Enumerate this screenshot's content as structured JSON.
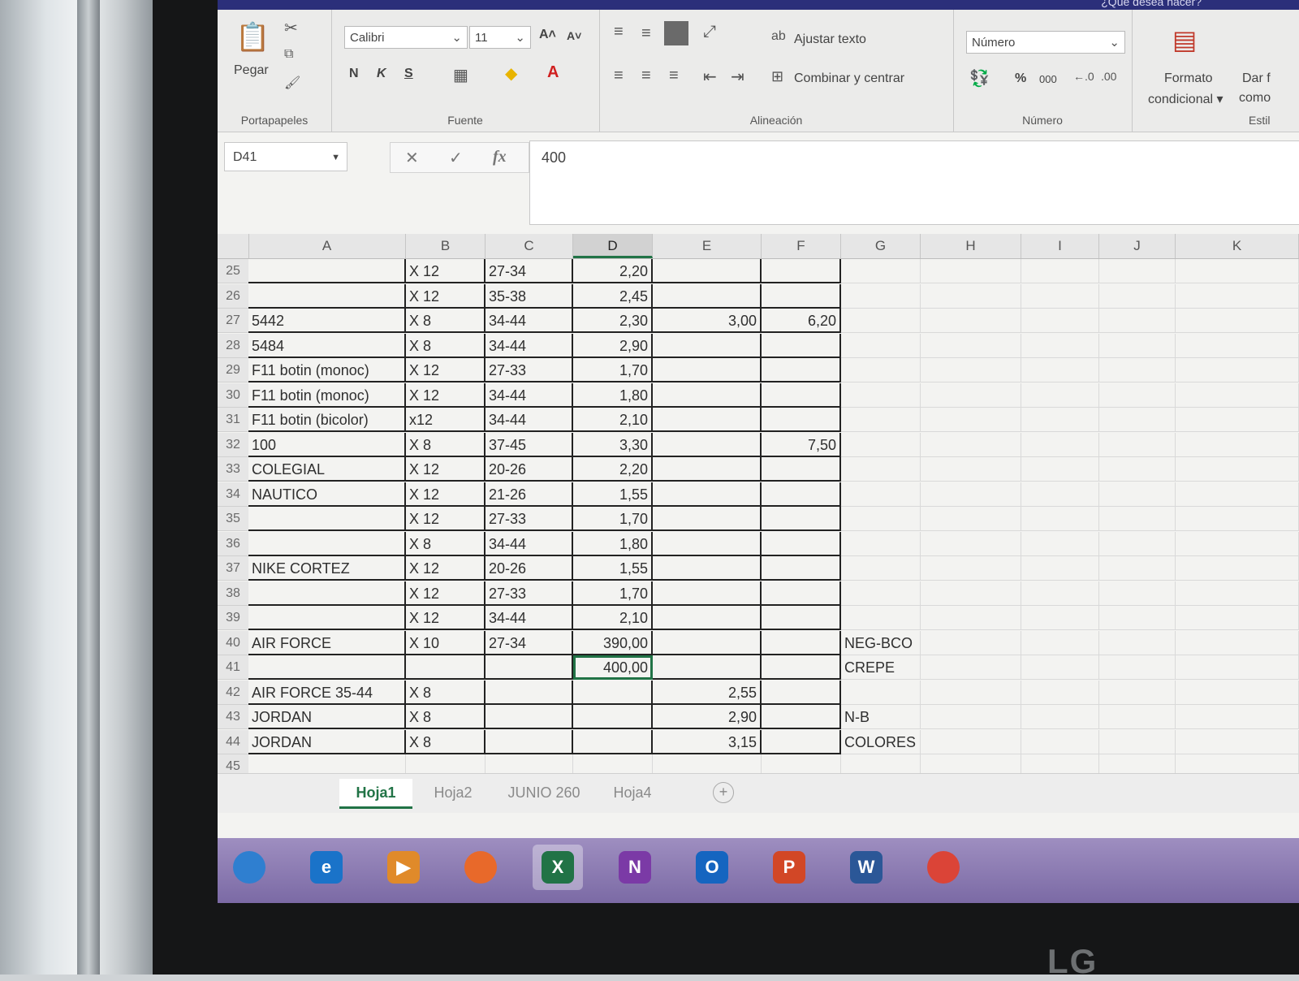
{
  "brand": "LG",
  "app": {
    "title_help": "¿Qué desea hacer?",
    "ribbon": {
      "clipboard": {
        "paste_label": "Pegar",
        "group_label": "Portapapeles"
      },
      "font": {
        "font_name": "Calibri",
        "font_size": "11",
        "bold": "N",
        "italic": "K",
        "underline": "S",
        "group_label": "Fuente"
      },
      "alignment": {
        "wrap_text": "Ajustar texto",
        "merge_center": "Combinar y centrar",
        "group_label": "Alineación"
      },
      "number": {
        "format": "Número",
        "percent": "%",
        "thousands": "000",
        "group_label": "Número"
      },
      "styles": {
        "conditional_line1": "Formato",
        "conditional_line2": "condicional ▾",
        "format_as_line1": "Dar f",
        "format_as_line2": "como",
        "group_label": "Estil"
      }
    },
    "formula_bar": {
      "name_box": "D41",
      "fx": "fx",
      "cancel": "✕",
      "confirm": "✓",
      "value": "400"
    },
    "columns": [
      "A",
      "B",
      "C",
      "D",
      "E",
      "F",
      "G",
      "H",
      "I",
      "J",
      "K"
    ],
    "active_column": "D",
    "rows": [
      {
        "n": "25",
        "A": "",
        "B": "X 12",
        "C": "27-34",
        "D": "2,20",
        "E": "",
        "F": "",
        "G": ""
      },
      {
        "n": "26",
        "A": "",
        "B": "X 12",
        "C": "35-38",
        "D": "2,45",
        "E": "",
        "F": "",
        "G": ""
      },
      {
        "n": "27",
        "A": "5442",
        "B": "X 8",
        "C": "34-44",
        "D": "2,30",
        "E": "3,00",
        "F": "6,20",
        "G": ""
      },
      {
        "n": "28",
        "A": "5484",
        "B": "X 8",
        "C": "34-44",
        "D": "2,90",
        "E": "",
        "F": "",
        "G": ""
      },
      {
        "n": "29",
        "A": "F11 botin (monoc)",
        "B": "X 12",
        "C": "27-33",
        "D": "1,70",
        "E": "",
        "F": "",
        "G": ""
      },
      {
        "n": "30",
        "A": "F11 botin (monoc)",
        "B": "X 12",
        "C": "34-44",
        "D": "1,80",
        "E": "",
        "F": "",
        "G": ""
      },
      {
        "n": "31",
        "A": "F11 botin (bicolor)",
        "B": "x12",
        "C": "34-44",
        "D": "2,10",
        "E": "",
        "F": "",
        "G": ""
      },
      {
        "n": "32",
        "A": "100",
        "B": "X 8",
        "C": "37-45",
        "D": "3,30",
        "E": "",
        "F": "7,50",
        "G": ""
      },
      {
        "n": "33",
        "A": "COLEGIAL",
        "B": "X 12",
        "C": "20-26",
        "D": "2,20",
        "E": "",
        "F": "",
        "G": ""
      },
      {
        "n": "34",
        "A": "NAUTICO",
        "B": "X 12",
        "C": "21-26",
        "D": "1,55",
        "E": "",
        "F": "",
        "G": ""
      },
      {
        "n": "35",
        "A": "",
        "B": "X 12",
        "C": "27-33",
        "D": "1,70",
        "E": "",
        "F": "",
        "G": ""
      },
      {
        "n": "36",
        "A": "",
        "B": "X 8",
        "C": "34-44",
        "D": "1,80",
        "E": "",
        "F": "",
        "G": ""
      },
      {
        "n": "37",
        "A": "NIKE CORTEZ",
        "B": "X 12",
        "C": "20-26",
        "D": "1,55",
        "E": "",
        "F": "",
        "G": ""
      },
      {
        "n": "38",
        "A": "",
        "B": "X 12",
        "C": "27-33",
        "D": "1,70",
        "E": "",
        "F": "",
        "G": ""
      },
      {
        "n": "39",
        "A": "",
        "B": "X 12",
        "C": "34-44",
        "D": "2,10",
        "E": "",
        "F": "",
        "G": ""
      },
      {
        "n": "40",
        "A": "AIR FORCE",
        "B": "X 10",
        "C": "27-34",
        "D": "390,00",
        "E": "",
        "F": "",
        "G": "NEG-BCO"
      },
      {
        "n": "41",
        "A": "",
        "B": "",
        "C": "",
        "D": "400,00",
        "E": "",
        "F": "",
        "G": "CREPE"
      },
      {
        "n": "42",
        "A": "AIR FORCE 35-44",
        "B": "X 8",
        "C": "",
        "D": "",
        "E": "2,55",
        "F": "",
        "G": ""
      },
      {
        "n": "43",
        "A": "JORDAN",
        "B": "X 8",
        "C": "",
        "D": "",
        "E": "2,90",
        "F": "",
        "G": "N-B"
      },
      {
        "n": "44",
        "A": "JORDAN",
        "B": "X 8",
        "C": "",
        "D": "",
        "E": "3,15",
        "F": "",
        "G": "COLORES"
      },
      {
        "n": "45",
        "A": "",
        "B": "",
        "C": "",
        "D": "",
        "E": "",
        "F": "",
        "G": ""
      }
    ],
    "selected_cell": "D41",
    "sheet_tabs": [
      "Hoja1",
      "Hoja2",
      "JUNIO 260",
      "Hoja4"
    ],
    "active_tab": "Hoja1",
    "add_sheet": "+"
  },
  "taskbar": {
    "items": [
      {
        "name": "start-orb-icon",
        "label": "",
        "color": "#2f7fd0"
      },
      {
        "name": "internet-explorer-icon",
        "label": "e",
        "color": "#1a73c9"
      },
      {
        "name": "media-player-icon",
        "label": "▶",
        "color": "#e08a2a"
      },
      {
        "name": "firefox-icon",
        "label": "",
        "color": "#e8692a"
      },
      {
        "name": "excel-icon",
        "label": "X",
        "color": "#217346"
      },
      {
        "name": "onenote-icon",
        "label": "N",
        "color": "#7b3aa6"
      },
      {
        "name": "outlook-icon",
        "label": "O",
        "color": "#1565c0"
      },
      {
        "name": "powerpoint-icon",
        "label": "P",
        "color": "#d24726"
      },
      {
        "name": "word-icon",
        "label": "W",
        "color": "#2b5797"
      },
      {
        "name": "chrome-icon",
        "label": "",
        "color": "#db4437"
      }
    ],
    "active": "excel-icon"
  }
}
